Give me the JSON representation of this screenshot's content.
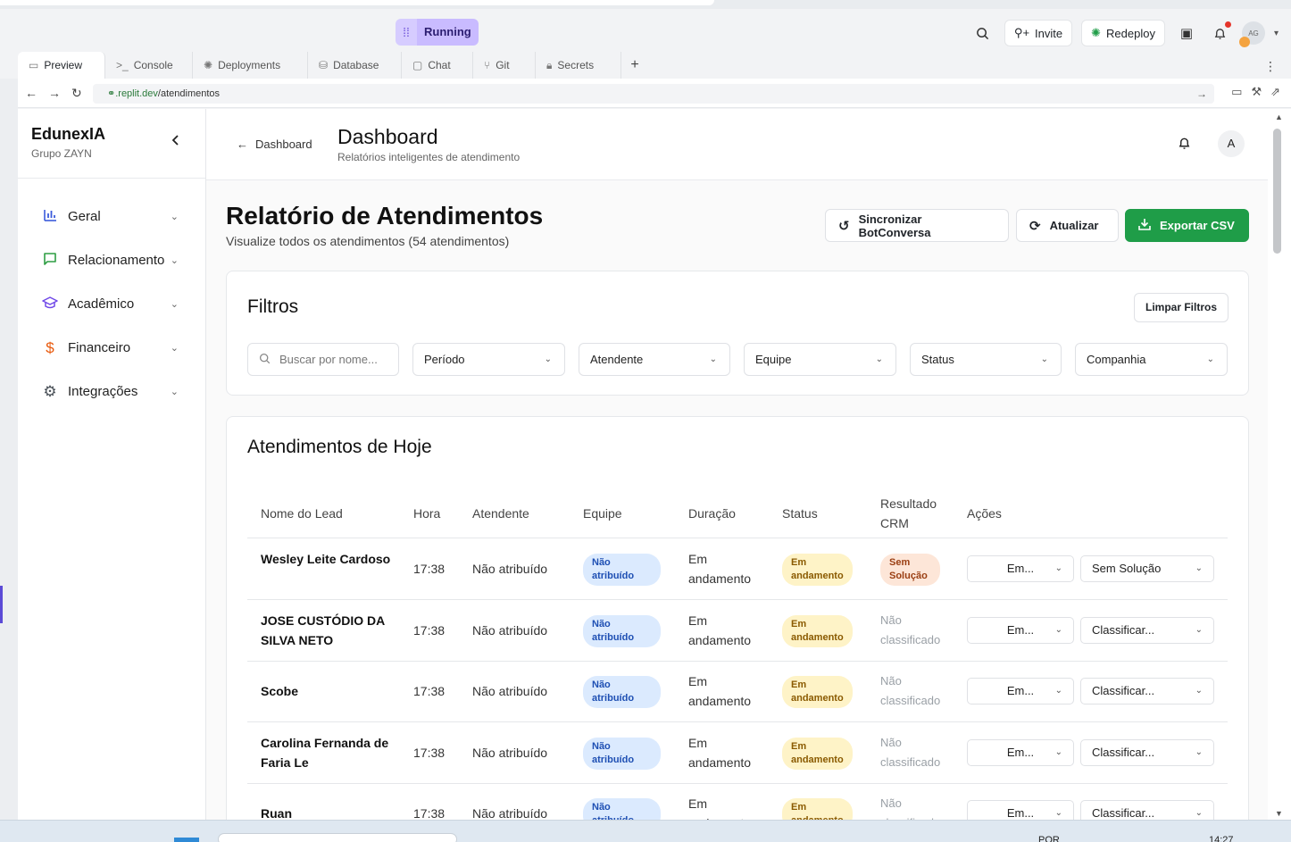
{
  "topbar": {
    "status": "Running",
    "invite_label": "Invite",
    "redeploy_label": "Redeploy",
    "avatar_initials": "AG"
  },
  "tabs": [
    {
      "label": "Preview",
      "icon": "monitor-icon"
    },
    {
      "label": "Console",
      "icon": "terminal-icon"
    },
    {
      "label": "Deployments",
      "icon": "deploy-icon"
    },
    {
      "label": "Database",
      "icon": "database-icon"
    },
    {
      "label": "Chat",
      "icon": "chat-icon"
    },
    {
      "label": "Git",
      "icon": "git-icon"
    },
    {
      "label": "Secrets",
      "icon": "lock-icon"
    }
  ],
  "url": {
    "domain": ".replit.dev",
    "path": "/atendimentos"
  },
  "sidebar": {
    "brand": "EdunexIA",
    "subtitle": "Grupo ZAYN",
    "items": [
      {
        "label": "Geral",
        "icon": "bar-chart-icon",
        "color": "#3b5bdb"
      },
      {
        "label": "Relacionamento",
        "icon": "message-square-icon",
        "color": "#2f9e44"
      },
      {
        "label": "Acadêmico",
        "icon": "graduation-cap-icon",
        "color": "#7048e8"
      },
      {
        "label": "Financeiro",
        "icon": "dollar-icon",
        "color": "#e8590c"
      },
      {
        "label": "Integrações",
        "icon": "gear-icon",
        "color": "#495057"
      }
    ]
  },
  "header": {
    "back_label": "Dashboard",
    "title": "Dashboard",
    "subtitle": "Relatórios inteligentes de atendimento",
    "avatar": "A"
  },
  "report": {
    "title": "Relatório de Atendimentos",
    "subtitle": "Visualize todos os atendimentos (54 atendimentos)",
    "sync_label": "Sincronizar BotConversa",
    "refresh_label": "Atualizar",
    "export_label": "Exportar CSV",
    "export_color": "#1f9d48"
  },
  "filters": {
    "title": "Filtros",
    "clear_label": "Limpar Filtros",
    "search_placeholder": "Buscar por nome...",
    "period": "Período",
    "attendant": "Atendente",
    "team": "Equipe",
    "status": "Status",
    "company": "Companhia"
  },
  "today": {
    "title": "Atendimentos de Hoje",
    "columns": [
      "Nome do Lead",
      "Hora",
      "Atendente",
      "Equipe",
      "Duração",
      "Status",
      "Resultado CRM",
      "Ações"
    ],
    "rows": [
      {
        "name": "Wesley Leite Cardoso",
        "time": "17:38",
        "attendant": "Não atribuído",
        "team": "Não atribuído",
        "duration": "Em andamento",
        "status": "Em andamento",
        "crm": "Sem Solução",
        "crm_pill": true,
        "action1": "Em...",
        "action2": "Sem Solução"
      },
      {
        "name": "JOSE CUSTÓDIO DA SILVA NETO",
        "time": "17:38",
        "attendant": "Não atribuído",
        "team": "Não atribuído",
        "duration": "Em andamento",
        "status": "Em andamento",
        "crm": "Não classificado",
        "crm_pill": false,
        "action1": "Em...",
        "action2": "Classificar..."
      },
      {
        "name": "Scobe",
        "time": "17:38",
        "attendant": "Não atribuído",
        "team": "Não atribuído",
        "duration": "Em andamento",
        "status": "Em andamento",
        "crm": "Não classificado",
        "crm_pill": false,
        "action1": "Em...",
        "action2": "Classificar..."
      },
      {
        "name": "Carolina Fernanda de Faria Le",
        "time": "17:38",
        "attendant": "Não atribuído",
        "team": "Não atribuído",
        "duration": "Em andamento",
        "status": "Em andamento",
        "crm": "Não classificado",
        "crm_pill": false,
        "action1": "Em...",
        "action2": "Classificar..."
      },
      {
        "name": "Ruan",
        "time": "17:38",
        "attendant": "Não atribuído",
        "team": "Não atribuído",
        "duration": "Em andamento",
        "status": "Em andamento",
        "crm": "Não classificado",
        "crm_pill": false,
        "action1": "Em...",
        "action2": "Classificar..."
      }
    ]
  },
  "taskbar": {
    "lang": "POR",
    "time": "14:27"
  }
}
